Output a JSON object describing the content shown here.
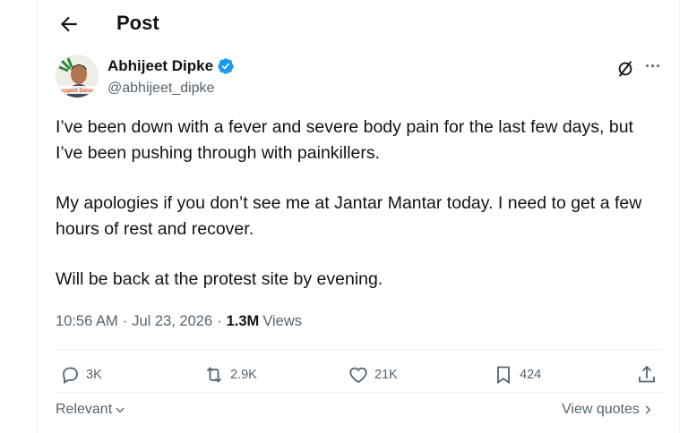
{
  "header": {
    "title": "Post"
  },
  "author": {
    "name": "Abhijeet Dipke",
    "handle": "@abhijeet_dipke",
    "avatar_text": "Support Sonam"
  },
  "post": {
    "paragraphs": [
      "I’ve been down with a fever and severe body pain for the last few days, but I’ve been pushing through with painkillers.",
      "My apologies if you don’t see me at Jantar Mantar today. I need to get a few hours of rest and recover.",
      "Will be back at the protest site by evening."
    ],
    "time": "10:56 AM",
    "sep": "·",
    "date": "Jul 23, 2026",
    "views_count": "1.3M",
    "views_label": "Views"
  },
  "actions": {
    "replies": "3K",
    "reposts": "2.9K",
    "likes": "21K",
    "bookmarks": "424"
  },
  "footer": {
    "sort_label": "Relevant",
    "quotes_label": "View quotes"
  },
  "colors": {
    "text": "#0f1419",
    "muted": "#536471",
    "verified": "#1d9bf0",
    "border": "#eff3f4"
  }
}
